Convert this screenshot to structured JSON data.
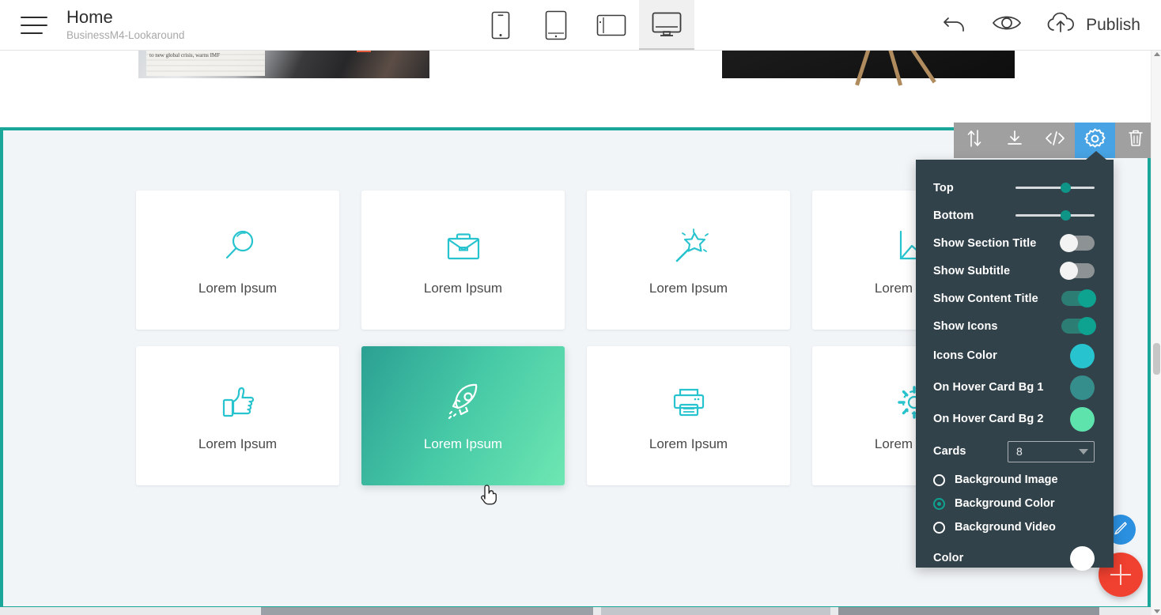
{
  "topbar": {
    "menu_icon": "hamburger-icon",
    "page_title": "Home",
    "page_subtitle": "BusinessM4-Lookaround",
    "devices": [
      {
        "name": "mobile",
        "label": "Mobile",
        "active": false
      },
      {
        "name": "tablet",
        "label": "Tablet",
        "active": false
      },
      {
        "name": "tablet-landscape",
        "label": "Tablet Landscape",
        "active": false
      },
      {
        "name": "desktop",
        "label": "Desktop",
        "active": true
      }
    ],
    "undo_label": "Undo",
    "preview_label": "Preview",
    "publish_label": "Publish"
  },
  "section_toolbar": {
    "buttons": [
      {
        "name": "move-section",
        "icon": "up-down-arrows-icon",
        "active": false
      },
      {
        "name": "save-section",
        "icon": "download-icon",
        "active": false
      },
      {
        "name": "edit-code",
        "icon": "code-icon",
        "active": false
      },
      {
        "name": "section-settings",
        "icon": "gear-icon",
        "active": true
      },
      {
        "name": "delete-section",
        "icon": "trash-icon",
        "active": false
      }
    ],
    "active_color": "#47a3e3",
    "bar_color": "#a0a0a0"
  },
  "panel": {
    "sliders": [
      {
        "label": "Top",
        "value": 57
      },
      {
        "label": "Bottom",
        "value": 57
      }
    ],
    "toggles": [
      {
        "label": "Show Section Title",
        "on": false
      },
      {
        "label": "Show Subtitle",
        "on": false
      },
      {
        "label": "Show Content Title",
        "on": true
      },
      {
        "label": "Show Icons",
        "on": true
      }
    ],
    "colors": [
      {
        "label": "Icons Color",
        "value": "#27c3ce"
      },
      {
        "label": "On Hover Card Bg 1",
        "value": "#368e8c"
      },
      {
        "label": "On Hover Card Bg 2",
        "value": "#5fe3ad"
      }
    ],
    "cards": {
      "label": "Cards",
      "value": "8"
    },
    "background_options": [
      {
        "label": "Background Image",
        "selected": false
      },
      {
        "label": "Background Color",
        "selected": true
      },
      {
        "label": "Background Video",
        "selected": false
      }
    ],
    "color_row": {
      "label": "Color",
      "value": "#ffffff"
    },
    "panel_bg": "#32424a"
  },
  "section": {
    "border_color": "#1aa79a",
    "background_color": "#f2f5f8",
    "icon_color": "#27c3ce",
    "cards": [
      {
        "title": "Lorem Ipsum",
        "icon": "magnifier-icon",
        "hovered": false
      },
      {
        "title": "Lorem Ipsum",
        "icon": "briefcase-icon",
        "hovered": false
      },
      {
        "title": "Lorem Ipsum",
        "icon": "magic-wand-icon",
        "hovered": false
      },
      {
        "title": "Lorem Ipsum",
        "icon": "line-chart-icon",
        "hovered": false
      },
      {
        "title": "Lorem Ipsum",
        "icon": "thumbs-up-icon",
        "hovered": false
      },
      {
        "title": "Lorem Ipsum",
        "icon": "rocket-icon",
        "hovered": true
      },
      {
        "title": "Lorem Ipsum",
        "icon": "printer-icon",
        "hovered": false
      },
      {
        "title": "Lorem Ipsum",
        "icon": "cog-icon",
        "hovered": false
      }
    ]
  },
  "fabs": [
    {
      "name": "style-editor-fab",
      "icon": "pen-icon",
      "color": "#2b90e0"
    },
    {
      "name": "add-block-fab",
      "icon": "plus-icon",
      "color": "#f0402f"
    }
  ]
}
